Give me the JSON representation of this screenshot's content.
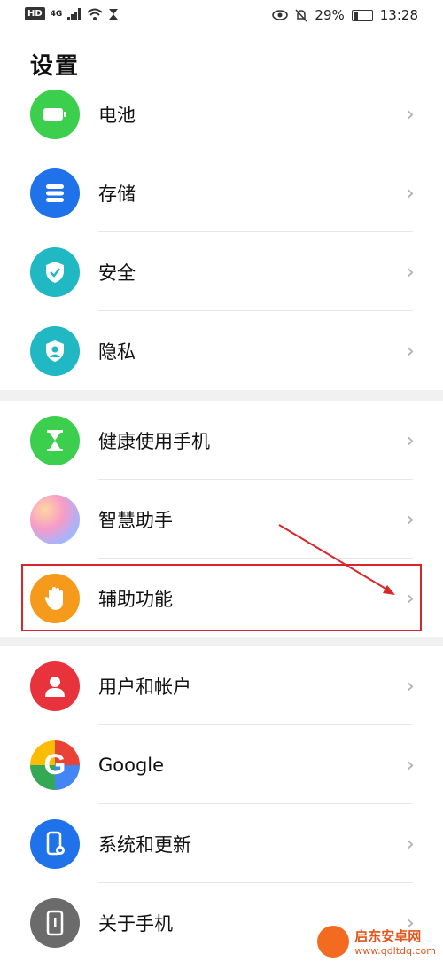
{
  "status_bar": {
    "hd_label": "HD",
    "network": "4G",
    "battery_percent": "29%",
    "time": "13:28"
  },
  "page": {
    "title": "设置"
  },
  "items": [
    {
      "label": "电池",
      "icon": "battery-icon",
      "color": "#3ccf4e"
    },
    {
      "label": "存储",
      "icon": "storage-icon",
      "color": "#1f72ea"
    },
    {
      "label": "安全",
      "icon": "shield-icon",
      "color": "#1fb8c3"
    },
    {
      "label": "隐私",
      "icon": "privacy-icon",
      "color": "#1fb8c3"
    },
    {
      "label": "健康使用手机",
      "icon": "hourglass-icon",
      "color": "#3ccf4e"
    },
    {
      "label": "智慧助手",
      "icon": "assistant-icon",
      "color": "#c9a9f0"
    },
    {
      "label": "辅助功能",
      "icon": "hand-icon",
      "color": "#f59a1b"
    },
    {
      "label": "用户和帐户",
      "icon": "user-icon",
      "color": "#e8323c"
    },
    {
      "label": "Google",
      "icon": "google-icon",
      "color": "#ffffff"
    },
    {
      "label": "系统和更新",
      "icon": "system-update-icon",
      "color": "#1f72ea"
    },
    {
      "label": "关于手机",
      "icon": "phone-info-icon",
      "color": "#6b6b6b"
    }
  ],
  "chevron": "›",
  "watermark": {
    "title": "启东安卓网",
    "url": "www.qdltdq.com"
  }
}
